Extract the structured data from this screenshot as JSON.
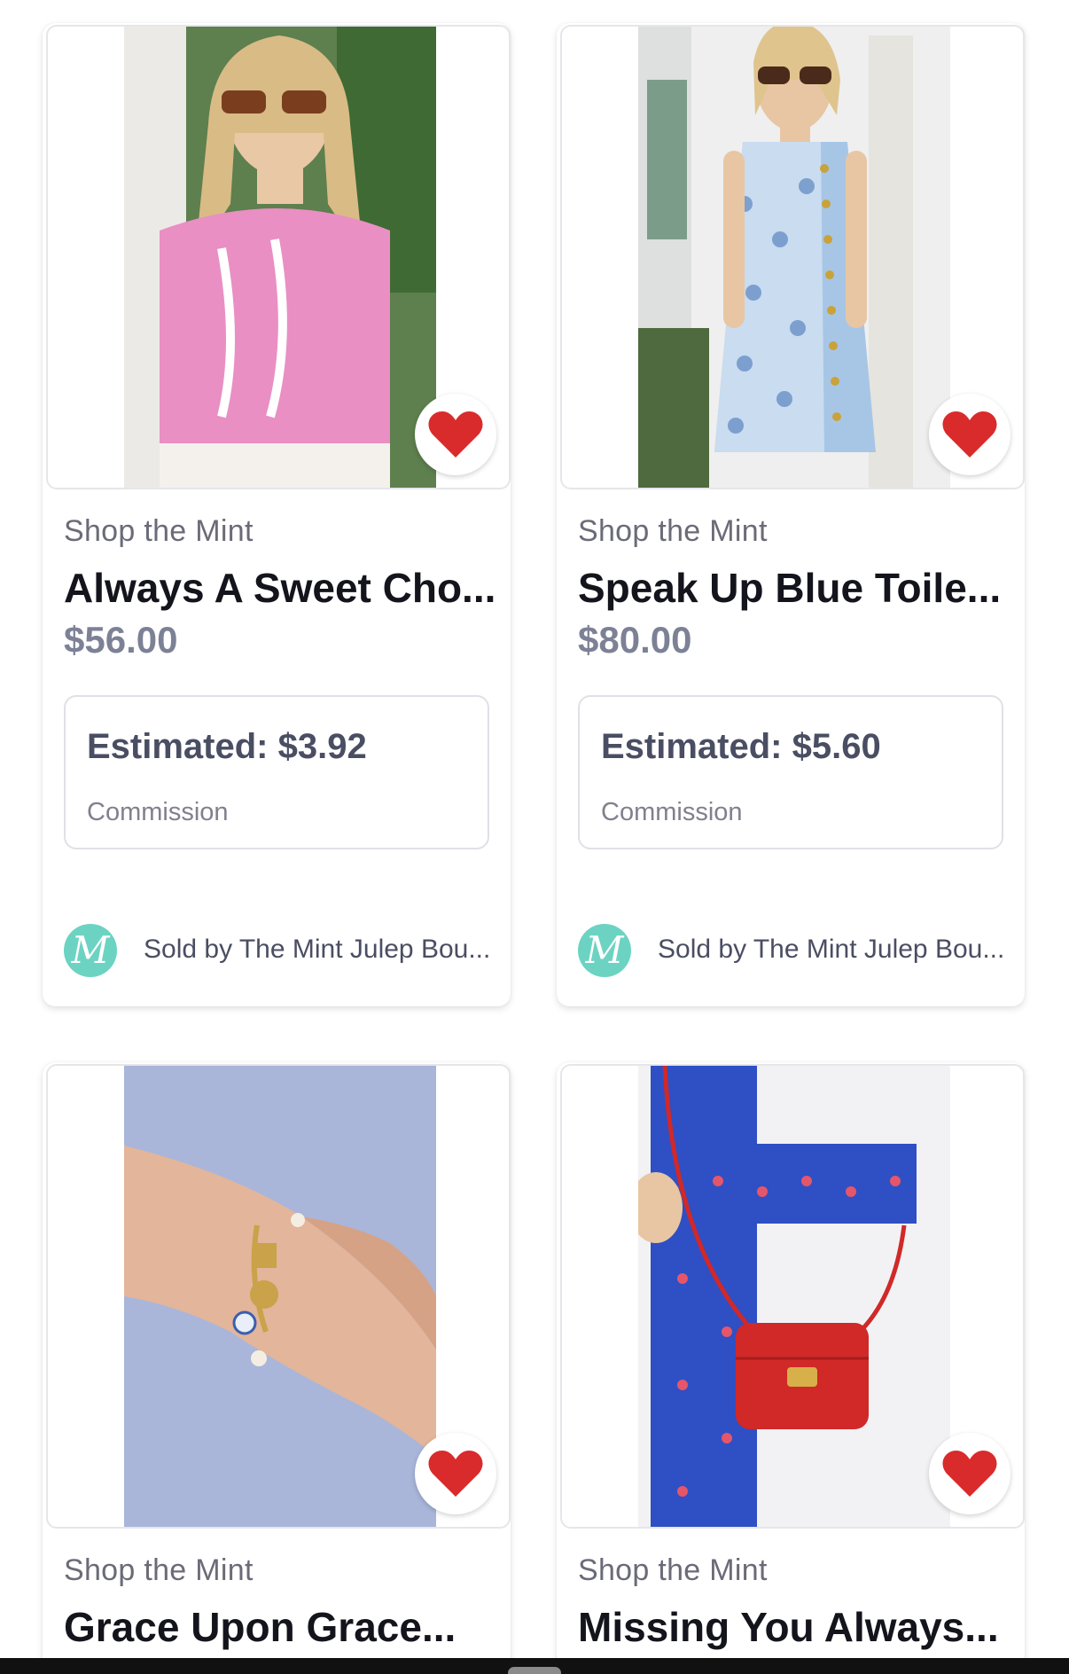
{
  "products": [
    {
      "store": "Shop the Mint",
      "title": "Always A Sweet Cho...",
      "price": "$56.00",
      "estimated": "Estimated: $3.92",
      "commission_label": "Commission",
      "seller_logo": "M",
      "seller": "Sold by The Mint Julep Bou...",
      "favorite": true
    },
    {
      "store": "Shop the Mint",
      "title": "Speak Up Blue Toile...",
      "price": "$80.00",
      "estimated": "Estimated: $5.60",
      "commission_label": "Commission",
      "seller_logo": "M",
      "seller": "Sold by The Mint Julep Bou...",
      "favorite": true
    },
    {
      "store": "Shop the Mint",
      "title": "Grace Upon Grace...",
      "favorite": true
    },
    {
      "store": "Shop the Mint",
      "title": "Missing You Always...",
      "favorite": true
    }
  ],
  "colors": {
    "heart": "#d92b2b",
    "seller_logo_bg": "#6cd3c2",
    "price": "#7d8196"
  },
  "icons": {
    "favorite": "heart-icon"
  }
}
